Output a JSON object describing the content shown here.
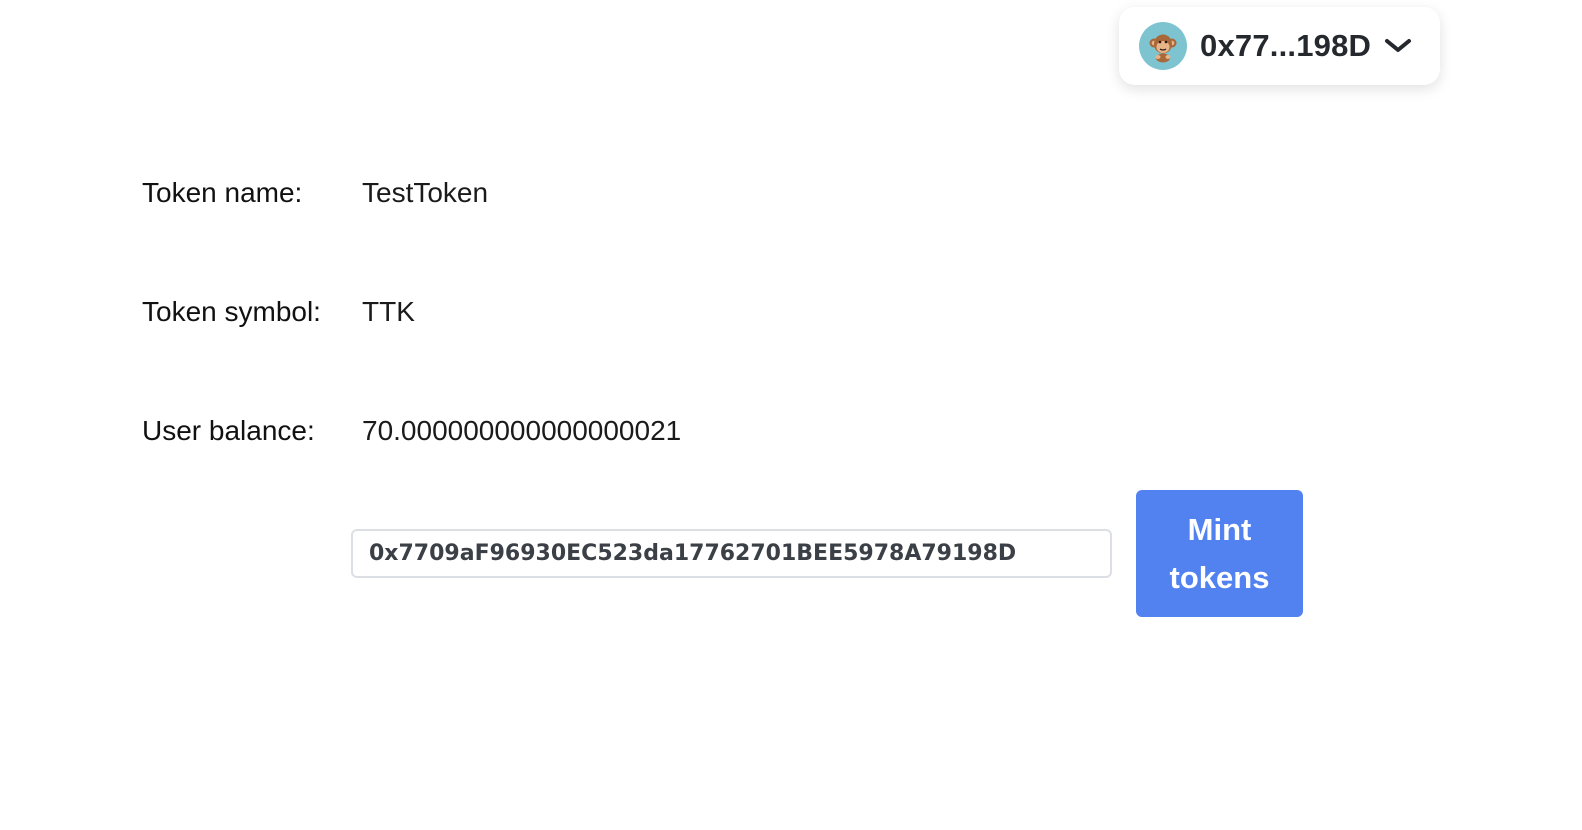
{
  "wallet": {
    "address_short": "0x77...198D",
    "avatar_icon": "monkey-emoji-icon",
    "avatar_bg": "#7ec4d0",
    "dropdown_icon": "chevron-down-icon"
  },
  "token": {
    "name_label": "Token name:",
    "name_value": "TestToken",
    "symbol_label": "Token symbol:",
    "symbol_value": "TTK",
    "balance_label": "User balance:",
    "balance_value": "70.000000000000000021"
  },
  "mint_form": {
    "address_value": "0x7709aF96930EC523da17762701BEE5978A79198D",
    "button_label": "Mint tokens",
    "button_color": "#5282ef"
  }
}
